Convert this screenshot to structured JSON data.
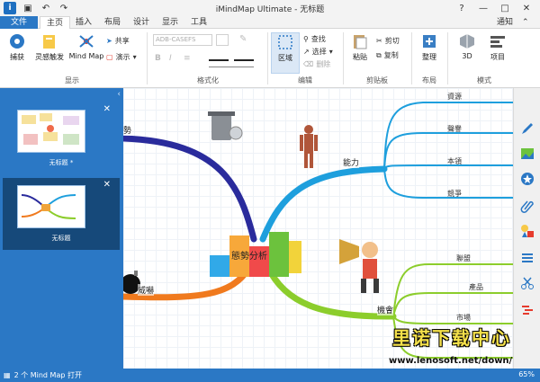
{
  "window": {
    "title": "iMindMap Ultimate - 无标题"
  },
  "menu": {
    "tabs": [
      "文件",
      "主页",
      "插入",
      "布局",
      "设计",
      "显示",
      "工具"
    ],
    "notify": "通知"
  },
  "ribbon": {
    "capture": "捕获",
    "brainstorm": "灵感触发",
    "mindmap": "Mind Map",
    "share": "共享",
    "present": "演示",
    "group_display": "显示",
    "font_name": "ADB-CASEFS",
    "group_format": "格式化",
    "region": "区域",
    "find": "查找",
    "select": "选择",
    "delete": "删除",
    "group_edit": "编辑",
    "paste": "粘贴",
    "cut": "剪切",
    "copy": "复制",
    "group_clipboard": "剪贴板",
    "organize": "整理",
    "group_layout": "布局",
    "view3d": "3D",
    "project": "项目",
    "group_mode": "模式"
  },
  "left_panel": {
    "thumbs": [
      {
        "caption": "无标题 *"
      },
      {
        "caption": "无标题"
      }
    ]
  },
  "mindmap": {
    "central": "態勢分析",
    "branches": {
      "top_left": "勢",
      "top_right": "能力",
      "bottom_left": "威嚇",
      "bottom_right": "機會"
    },
    "leaves_ability": [
      "資源",
      "聲譽",
      "本領",
      "競爭"
    ],
    "leaves_opportunity": [
      "聯盟",
      "產品",
      "市場"
    ]
  },
  "status": {
    "left": "2 个 Mind Map 打开",
    "zoom": "65%"
  },
  "watermark": {
    "cn": "里诺下载中心",
    "url": "www.lenosoft.net/down/"
  },
  "colors": {
    "accent": "#2b78c5",
    "branch_blue": "#1e9fdd",
    "branch_navy": "#2a2b9c",
    "branch_orange": "#f07a1e",
    "branch_green": "#8ccd2c"
  }
}
